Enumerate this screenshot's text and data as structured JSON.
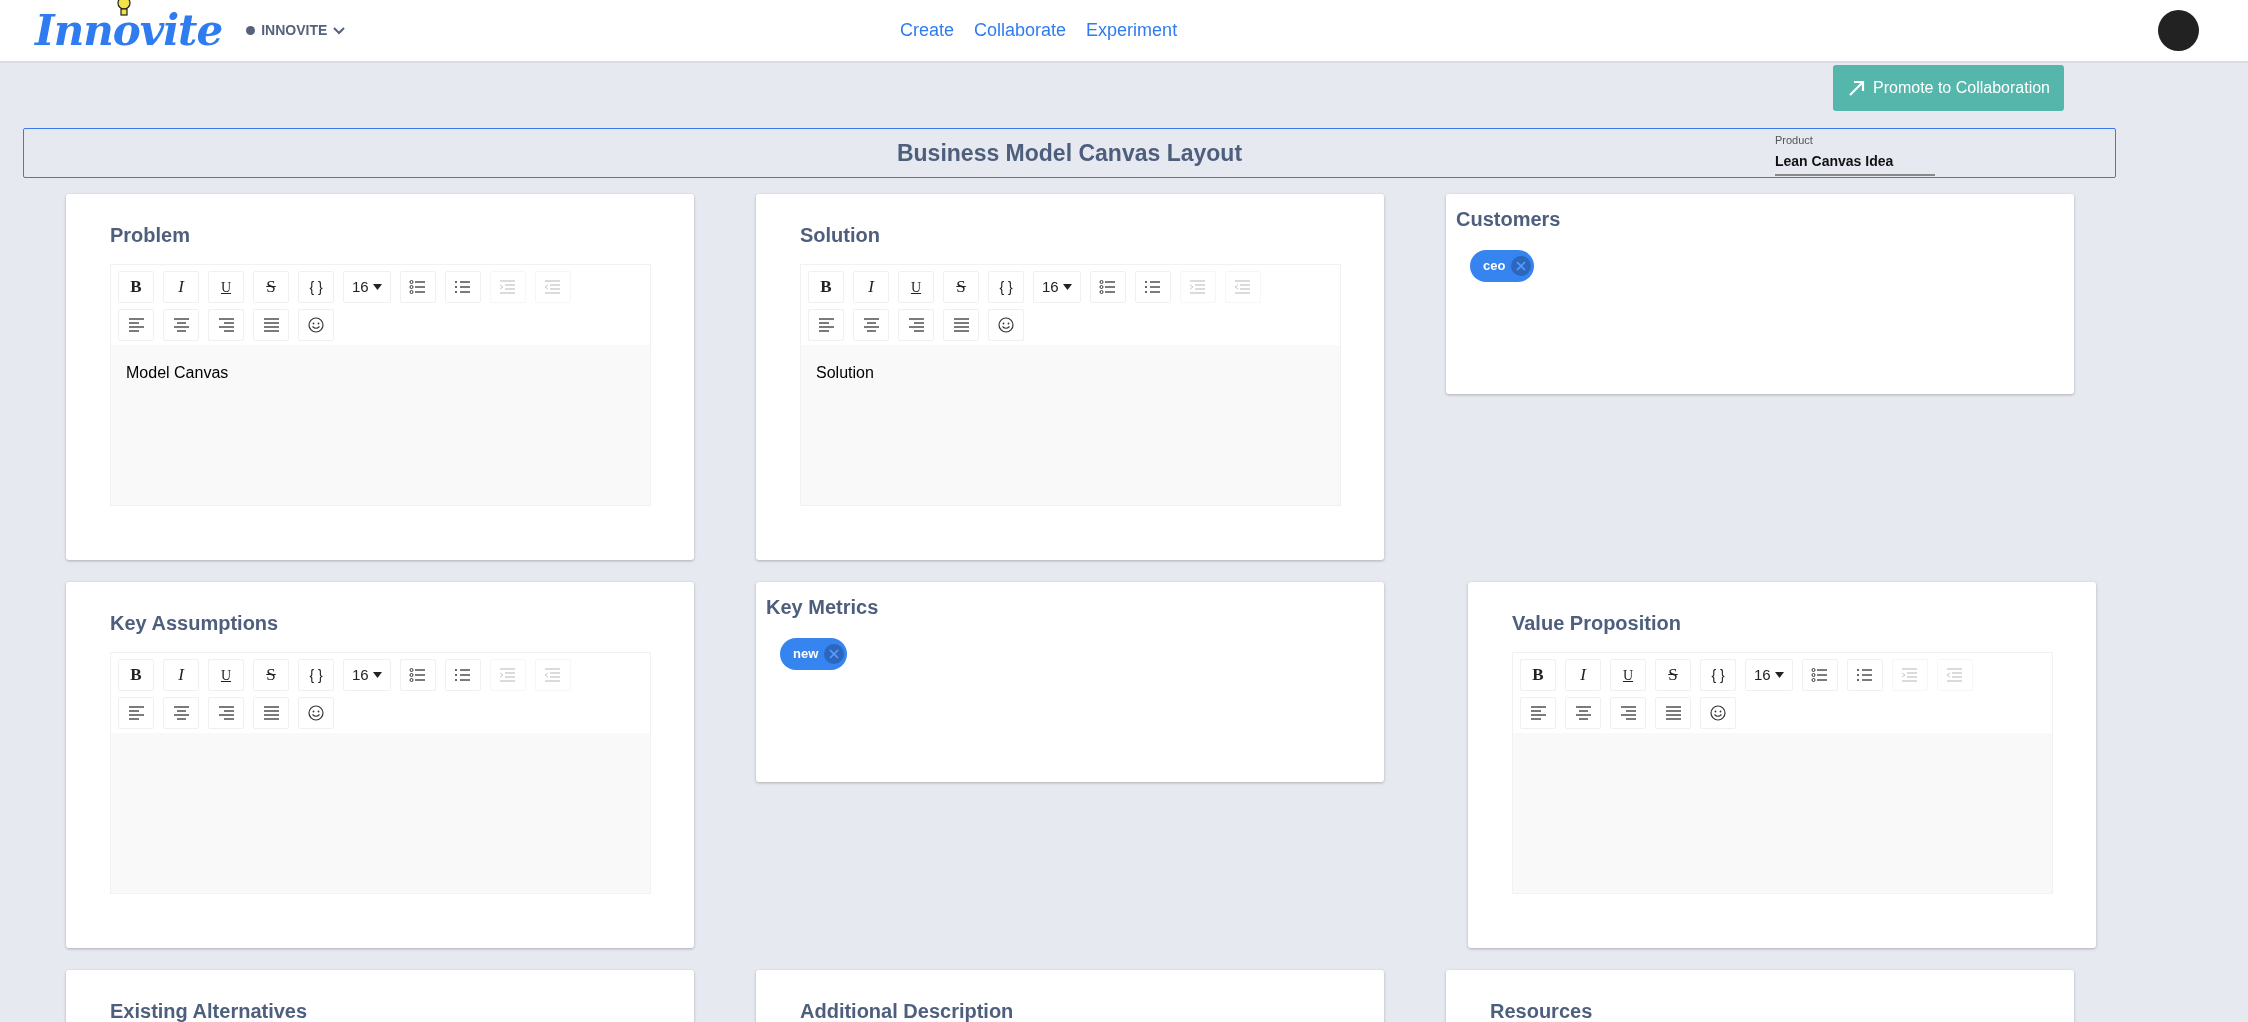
{
  "header": {
    "logo": "Innovite",
    "workspace": "INNOVITE",
    "nav": [
      {
        "label": "Create"
      },
      {
        "label": "Collaborate"
      },
      {
        "label": "Experiment"
      }
    ]
  },
  "promote_button": {
    "label": "Promote to Collaboration"
  },
  "canvas": {
    "title": "Business Model Canvas Layout",
    "product": {
      "label": "Product",
      "value": "Lean Canvas Idea"
    }
  },
  "rows": [
    {
      "cards": [
        {
          "kind": "editor",
          "title": "Problem",
          "content": "Model Canvas",
          "toolbar": [
            {
              "kind": "bold",
              "label": "B",
              "disabled": false
            },
            {
              "kind": "italic",
              "label": "I",
              "disabled": false
            },
            {
              "kind": "underline",
              "label": "U",
              "disabled": false
            },
            {
              "kind": "strike",
              "label": "S",
              "disabled": false
            },
            {
              "kind": "code",
              "label": "{ }",
              "disabled": false
            },
            {
              "kind": "size",
              "label": "16",
              "disabled": false
            },
            {
              "kind": "bullets",
              "disabled": false
            },
            {
              "kind": "numbers",
              "disabled": false
            },
            {
              "kind": "indent",
              "disabled": true
            },
            {
              "kind": "outdent",
              "disabled": true
            },
            {
              "kind": "break"
            },
            {
              "kind": "align-left",
              "disabled": false
            },
            {
              "kind": "align-center",
              "disabled": false
            },
            {
              "kind": "align-right",
              "disabled": false
            },
            {
              "kind": "justify",
              "disabled": false
            },
            {
              "kind": "emoji",
              "disabled": false
            }
          ]
        },
        {
          "kind": "editor",
          "title": "Solution",
          "content": "Solution",
          "toolbar": [
            {
              "kind": "bold",
              "label": "B",
              "disabled": false
            },
            {
              "kind": "italic",
              "label": "I",
              "disabled": false
            },
            {
              "kind": "underline",
              "label": "U",
              "disabled": false
            },
            {
              "kind": "strike",
              "label": "S",
              "disabled": false
            },
            {
              "kind": "code",
              "label": "{ }",
              "disabled": false
            },
            {
              "kind": "size",
              "label": "16",
              "disabled": false
            },
            {
              "kind": "bullets",
              "disabled": false
            },
            {
              "kind": "numbers",
              "disabled": false
            },
            {
              "kind": "indent",
              "disabled": true
            },
            {
              "kind": "outdent",
              "disabled": true
            },
            {
              "kind": "break"
            },
            {
              "kind": "align-left",
              "disabled": false
            },
            {
              "kind": "align-center",
              "disabled": false
            },
            {
              "kind": "align-right",
              "disabled": false
            },
            {
              "kind": "justify",
              "disabled": false
            },
            {
              "kind": "emoji",
              "disabled": false
            }
          ]
        },
        {
          "kind": "tags",
          "title": "Customers",
          "tags": [
            "ceo"
          ]
        }
      ]
    },
    {
      "cards": [
        {
          "kind": "editor",
          "title": "Key Assumptions",
          "toolbar": [
            {
              "kind": "bold",
              "label": "B",
              "disabled": false
            },
            {
              "kind": "italic",
              "label": "I",
              "disabled": false
            },
            {
              "kind": "underline",
              "label": "U",
              "disabled": false
            },
            {
              "kind": "strike",
              "label": "S",
              "disabled": false
            },
            {
              "kind": "code",
              "label": "{ }",
              "disabled": false
            },
            {
              "kind": "size",
              "label": "16",
              "disabled": false
            },
            {
              "kind": "bullets",
              "disabled": false
            },
            {
              "kind": "numbers",
              "disabled": false
            },
            {
              "kind": "indent",
              "disabled": true
            },
            {
              "kind": "outdent",
              "disabled": true
            },
            {
              "kind": "break"
            },
            {
              "kind": "align-left",
              "disabled": false
            },
            {
              "kind": "align-center",
              "disabled": false
            },
            {
              "kind": "align-right",
              "disabled": false
            },
            {
              "kind": "justify",
              "disabled": false
            },
            {
              "kind": "emoji",
              "disabled": false
            }
          ]
        },
        {
          "kind": "tags",
          "title": "Key Metrics",
          "tags": [
            "new"
          ]
        },
        {
          "kind": "editor",
          "title": "Value Proposition",
          "toolbar": [
            {
              "kind": "bold",
              "label": "B",
              "disabled": false
            },
            {
              "kind": "italic",
              "label": "I",
              "disabled": false
            },
            {
              "kind": "underline",
              "label": "U",
              "disabled": false
            },
            {
              "kind": "strike",
              "label": "S",
              "disabled": false
            },
            {
              "kind": "code",
              "label": "{ }",
              "disabled": false
            },
            {
              "kind": "size",
              "label": "16",
              "disabled": false
            },
            {
              "kind": "bullets",
              "disabled": false
            },
            {
              "kind": "numbers",
              "disabled": false
            },
            {
              "kind": "indent",
              "disabled": true
            },
            {
              "kind": "outdent",
              "disabled": true
            },
            {
              "kind": "break"
            },
            {
              "kind": "align-left",
              "disabled": false
            },
            {
              "kind": "align-center",
              "disabled": false
            },
            {
              "kind": "align-right",
              "disabled": false
            },
            {
              "kind": "justify",
              "disabled": false
            },
            {
              "kind": "emoji",
              "disabled": false
            }
          ]
        }
      ]
    },
    {
      "cards": [
        {
          "kind": "editor",
          "title": "Existing Alternatives"
        },
        {
          "kind": "editor",
          "title": "Additional Description"
        },
        {
          "kind": "editor",
          "title": "Resources"
        }
      ]
    }
  ]
}
